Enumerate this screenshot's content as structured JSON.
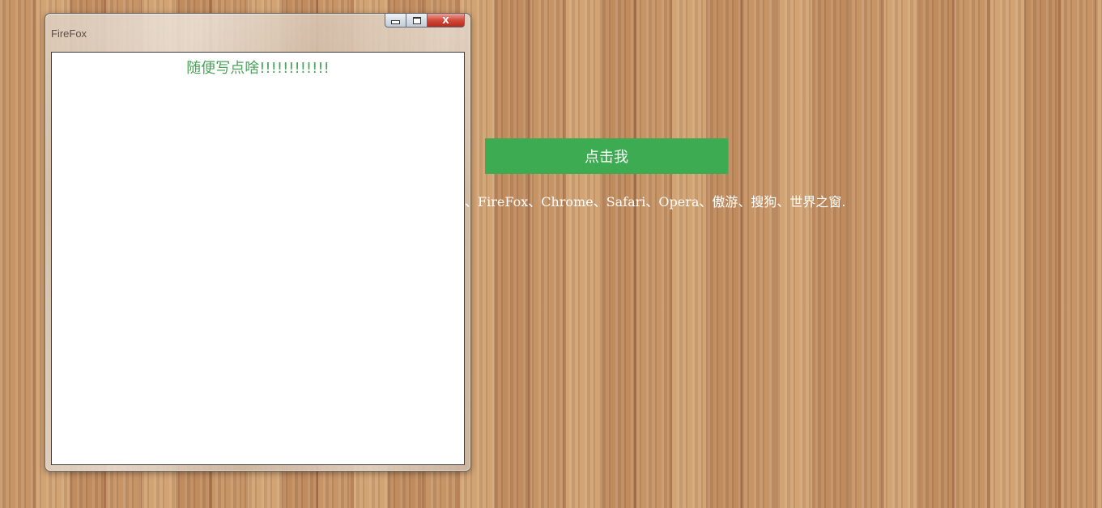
{
  "window": {
    "title": "FireFox",
    "content_text": "随便写点啥!!!!!!!!!!!!",
    "controls": {
      "minimize_icon": "minimize-icon",
      "maximize_icon": "maximize-icon",
      "close_label": "X"
    }
  },
  "page": {
    "button_label": "点击我",
    "browser_list": "、FireFox、Chrome、Safari、Opera、傲游、搜狗、世界之窗."
  },
  "colors": {
    "button": "#3dab52",
    "content_text": "#4aa35a",
    "close_button": "#d04a3a",
    "background": "#c08a5c"
  }
}
